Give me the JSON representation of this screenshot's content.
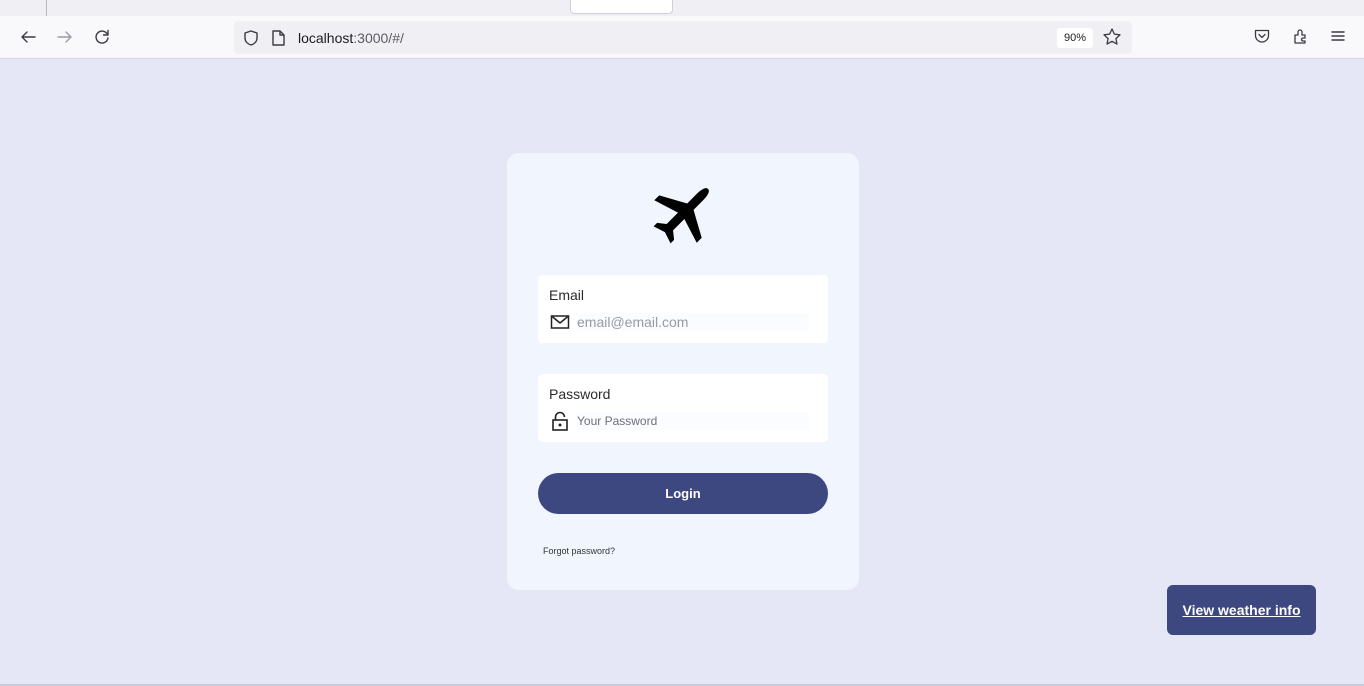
{
  "browser": {
    "url_host": "localhost",
    "url_rest": ":3000/#/",
    "zoom": "90%"
  },
  "icons": {
    "back": "back-arrow-icon",
    "forward": "forward-arrow-icon",
    "reload": "reload-icon",
    "shield": "shield-icon",
    "page": "page-icon",
    "bookmark": "star-icon",
    "pocket": "pocket-icon",
    "extensions": "extensions-icon",
    "menu": "hamburger-menu-icon",
    "logo": "airplane-icon",
    "email": "envelope-icon",
    "password": "lock-icon"
  },
  "login": {
    "email_label": "Email",
    "email_placeholder": "email@email.com",
    "password_label": "Password",
    "password_placeholder": "Your Password",
    "submit_label": "Login",
    "forgot_label": "Forgot password?"
  },
  "weather_button_label": "View weather info",
  "colors": {
    "page_background": "#e6e7f6",
    "card_background": "#f0f5fe",
    "primary": "#3d4780"
  }
}
